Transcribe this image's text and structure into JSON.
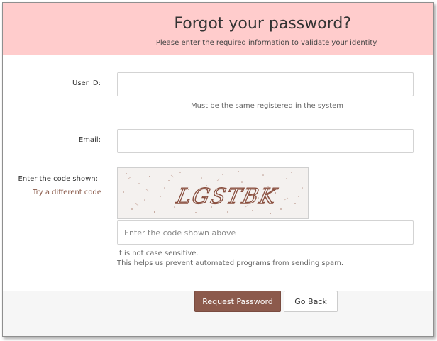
{
  "header": {
    "title": "Forgot your password?",
    "subtitle": "Please enter the required information to validate your identity."
  },
  "form": {
    "user_id_label": "User ID:",
    "user_id_value": "",
    "user_id_hint": "Must be the same registered in the system",
    "email_label": "Email:",
    "email_value": "",
    "code_label": "Enter the code shown:",
    "try_different_code": "Try a different code",
    "captcha_text": "LGSTBK",
    "code_placeholder": "Enter the code shown above",
    "case_note": "It is not case sensitive.",
    "spam_note": "This helps us prevent automated programs from sending spam."
  },
  "buttons": {
    "request_password": "Request Password",
    "go_back": "Go Back"
  },
  "colors": {
    "header_bg": "#ffcccc",
    "primary_button": "#8c5a4c",
    "link": "#8a5a4a"
  }
}
